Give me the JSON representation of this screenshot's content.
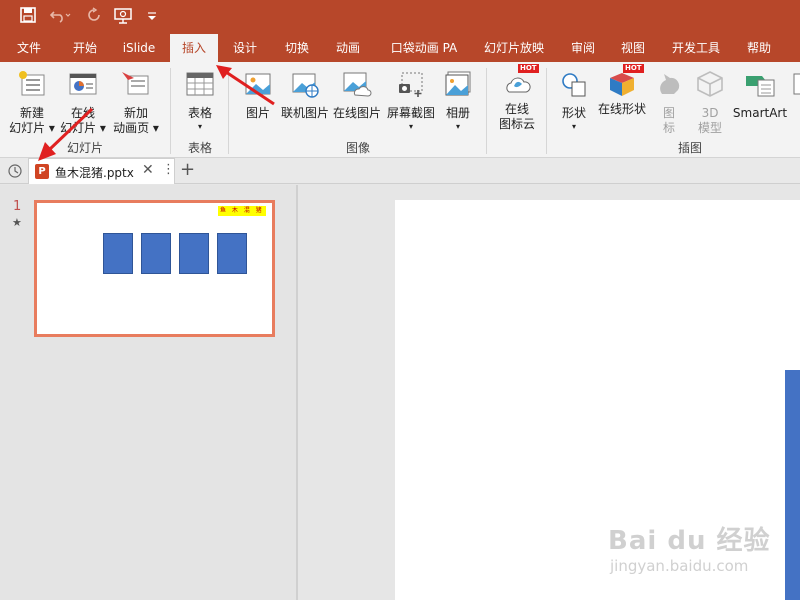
{
  "quick_access": {
    "save_icon": "save-icon",
    "undo_icon": "undo-icon",
    "redo_icon": "redo-icon",
    "present_icon": "present-icon",
    "customize_icon": "customize-icon"
  },
  "tabs": [
    "文件",
    "开始",
    "iSlide",
    "插入",
    "设计",
    "切换",
    "动画",
    "口袋动画 PA",
    "幻灯片放映",
    "审阅",
    "视图",
    "开发工具",
    "帮助"
  ],
  "active_tab": "插入",
  "ribbon": {
    "new_slide": "新建\n幻灯片 ▾",
    "online_slide": "在线\n幻灯片 ▾",
    "new_anim_page": "新加\n动画页 ▾",
    "group_slides": "幻灯片",
    "table": "表格",
    "group_table": "表格",
    "picture": "图片",
    "online_pic": "联机图片",
    "online_image": "在线图片",
    "screenshot": "屏幕截图",
    "album": "相册",
    "group_image": "图像",
    "online_icon_cloud": "在线\n图标云",
    "shapes": "形状",
    "online_shapes": "在线形状",
    "icons": "图\n标",
    "model3d": "3D\n模型",
    "smartart": "SmartArt",
    "group_illus": "插图",
    "hot_label": "HOT"
  },
  "document": {
    "filename": "鱼木混猪.pptx",
    "close": "✕",
    "more": "⋮",
    "add": "+"
  },
  "slides": {
    "number": "1",
    "star": "★",
    "thumb_tag": "鱼 木 混 猪"
  },
  "watermark": {
    "brand": "Bai du 经验",
    "url": "jingyan.baidu.com"
  },
  "colors": {
    "accent": "#b7472a",
    "box": "#4472c4",
    "thumb_border": "#e87c5e",
    "annotation_arrow": "#e02020"
  }
}
